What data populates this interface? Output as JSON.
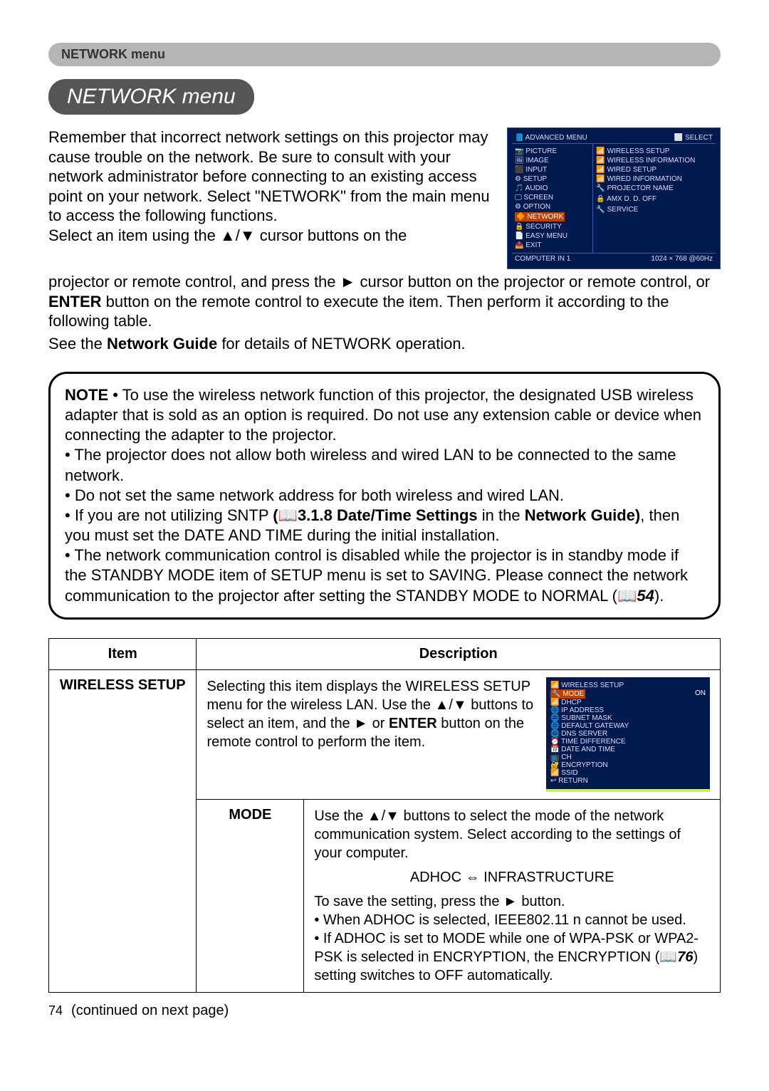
{
  "banner": "NETWORK menu",
  "title": "NETWORK menu",
  "intro1": "Remember that incorrect network settings on this projector may cause trouble on the network. Be sure to consult with your network administrator before connecting to an existing access point on your network. Select \"NETWORK\" from the main menu to access the following functions.",
  "intro2": "Select an item using the ▲/▼ cursor buttons on the",
  "body1": "projector or remote control, and press the ► cursor button on the projector or remote control, or ",
  "enter": "ENTER",
  "body1b": " button on the remote control to execute the item. Then perform it according to the following table.",
  "body2a": "See the ",
  "ng": "Network Guide",
  "body2b": " for details of NETWORK operation.",
  "note_lead": "NOTE",
  "note1": " • To use the wireless network function of this projector, the designated USB wireless adapter that is sold as an option is required. Do not use any extension cable or device when connecting the adapter to the projector.",
  "note2": "• The projector does not allow both wireless and wired LAN to be connected to the same network.",
  "note3": "• Do not set the same network address for both wireless and wired LAN.",
  "note4a": "• If you are not utilizing SNTP ",
  "note4b": "(📖3.1.8 Date/Time Settings",
  "note4c": " in the ",
  "note4d": "Network Guide)",
  "note4e": ", then you must set the DATE AND TIME during the initial installation.",
  "note5a": "• The network communication control is disabled while the projector is in standby mode if the STANDBY MODE item of SETUP menu is set to SAVING. Please connect the network communication to the projector after setting the STANDBY MODE to NORMAL (📖",
  "note5b": "54",
  "note5c": ").",
  "th_item": "Item",
  "th_desc": "Description",
  "row_item": "WIRELESS SETUP",
  "desc_intro": "Selecting this item displays the WIRELESS SETUP menu for the wireless LAN. Use the ▲/▼ buttons to select an item, and the ► or ",
  "desc_enter": "ENTER",
  "desc_intro2": " button on the remote control to perform the item.",
  "mode_label": "MODE",
  "mode_p1": "Use the ▲/▼ buttons to select the mode of the network communication system. Select according to the settings of your computer.",
  "mode_adhoc": "ADHOC ⇔ INFRASTRUCTURE",
  "mode_p2": "To save the setting, press the ► button.",
  "mode_p3": "• When ADHOC is selected, IEEE802.11 n cannot be used.",
  "mode_p4a": "• If ADHOC is set to MODE while one of WPA-PSK or WPA2-PSK is selected in ENCRYPTION, the ENCRYPTION (📖",
  "mode_p4b": "76",
  "mode_p4c": ") setting switches to OFF automatically.",
  "page_num": "74",
  "cont": "(continued on next page)",
  "osd": {
    "hdr_left": "📘 ADVANCED MENU",
    "hdr_right": "⬜ SELECT",
    "left": [
      "📷 PICTURE",
      "🖼 IMAGE",
      "⬛ INPUT",
      "⚙ SETUP",
      "🎵 AUDIO",
      "🖵 SCREEN",
      "⚙ OPTION"
    ],
    "left_hl": "🔶 NETWORK",
    "left2": [
      "🔒 SECURITY",
      "📄 EASY MENU",
      "📤 EXIT"
    ],
    "right": [
      "📶 WIRELESS SETUP",
      "📶 WIRELESS INFORMATION",
      "📶 WIRED SETUP",
      "📶 WIRED INFORMATION",
      "🔧 PROJECTOR NAME",
      "",
      "🔒 AMX D. D.          OFF",
      "",
      "🔧 SERVICE"
    ],
    "foot_left": "COMPUTER IN 1",
    "foot_right": "1024 × 768 @60Hz"
  },
  "mini": {
    "title": "📶 WIRELESS SETUP",
    "hl": "🔧 MODE",
    "on": "ON",
    "items": [
      "📶 DHCP",
      "🌐 IP ADDRESS",
      "🌐 SUBNET MASK",
      "🌐 DEFAULT GATEWAY",
      "🌐 DNS SERVER",
      "⏰ TIME DIFFERENCE",
      "📅 DATE AND TIME",
      "📺 CH",
      "🔐 ENCRYPTION",
      "📶 SSID",
      "↩ RETURN"
    ]
  }
}
